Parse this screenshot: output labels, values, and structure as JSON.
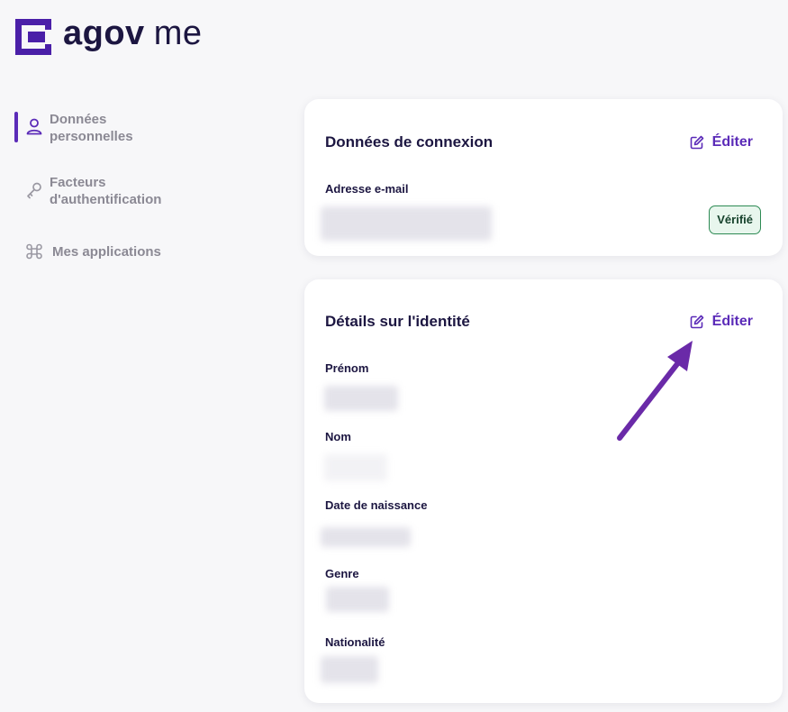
{
  "logo": {
    "brand_strong": "agov",
    "brand_light": "me",
    "accent": "#4a1fa8"
  },
  "sidebar": {
    "items": [
      {
        "label_line1": "Données",
        "label_line2": "personnelles",
        "icon": "user-icon",
        "active": true
      },
      {
        "label_line1": "Facteurs",
        "label_line2": "d'authentification",
        "icon": "key-icon",
        "active": false
      },
      {
        "label_line1": "Mes applications",
        "icon": "command-icon",
        "active": false
      }
    ]
  },
  "login_card": {
    "title": "Données de connexion",
    "edit_label": "Éditer",
    "email_label": "Adresse e-mail",
    "status_badge": "Vérifié"
  },
  "identity_card": {
    "title": "Détails sur l'identité",
    "edit_label": "Éditer",
    "fields": [
      {
        "label": "Prénom"
      },
      {
        "label": "Nom"
      },
      {
        "label": "Date de naissance"
      },
      {
        "label": "Genre"
      },
      {
        "label": "Nationalité"
      }
    ]
  },
  "colors": {
    "accent": "#5b2bb8",
    "text": "#1c1641",
    "muted": "#8b8994",
    "badge_border": "#2d8a54",
    "annotation_arrow": "#6a2aa8"
  }
}
